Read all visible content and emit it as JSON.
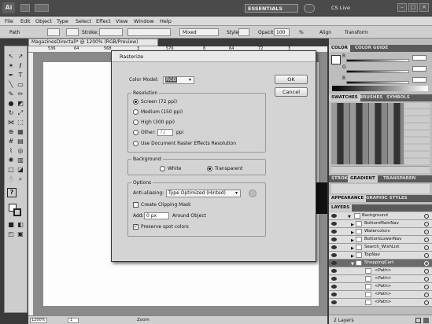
{
  "appbar": {
    "logo": "Ai",
    "workspace": "ESSENTIALS",
    "cslive": "CS Live",
    "win_min": "–",
    "win_max": "□",
    "win_close": "×"
  },
  "menu": {
    "items": [
      "File",
      "Edit",
      "Object",
      "Type",
      "Select",
      "Effect",
      "View",
      "Window",
      "Help"
    ]
  },
  "control": {
    "selection": "Path",
    "stroke_label": "Stroke:",
    "brush_value": "Mixed",
    "style_label": "Style:",
    "opacity_label": "Opacity:",
    "opacity_value": "100",
    "opacity_unit": "%",
    "align_label": "Align",
    "transform_label": "Transform"
  },
  "document": {
    "tab_title": "MagazinesDirectall* @ 1200% (RGB/Preview)",
    "ruler_ticks": [
      "536",
      "64",
      "568",
      "3",
      "576",
      "8",
      "64",
      "72",
      "3"
    ],
    "zoom": "1200%",
    "page": "1",
    "status": "Zoom"
  },
  "dialog": {
    "title": "Rasterize",
    "color_model_label": "Color Model:",
    "color_model_value": "RGB",
    "ok_label": "OK",
    "cancel_label": "Cancel",
    "resolution_group": "Resolution",
    "res_screen": "Screen (72 ppi)",
    "res_medium": "Medium (150 ppi)",
    "res_high": "High (300 ppi)",
    "res_other": "Other:",
    "res_other_value": "72",
    "res_other_unit": "ppi",
    "res_doc": "Use Document Raster Effects Resolution",
    "background_group": "Background",
    "bg_white": "White",
    "bg_transparent": "Transparent",
    "options_group": "Options",
    "antialias_label": "Anti-aliasing:",
    "antialias_value": "Type Optimized (Hinted)",
    "clipping_label": "Create Clipping Mask",
    "add_label": "Add:",
    "add_value": "0 px",
    "add_suffix": "Around Object",
    "preserve_label": "Preserve spot colors"
  },
  "panels": {
    "color_tab": "COLOR",
    "guide_tab": "COLOR GUIDE",
    "r": "R",
    "g": "G",
    "b": "B",
    "swatches_tab": "SWATCHES",
    "brushes_tab": "BRUSHES",
    "symbols_tab": "SYMBOLS",
    "stroke_tab": "STROK",
    "gradient_tab": "GRADIENT",
    "transparency_tab": "TRANSPAREN",
    "appearance_tab": "APPEARANCE",
    "graphic_styles_tab": "GRAPHIC STYLES",
    "layers_tab": "LAYERS",
    "layers_count": "2 Layers",
    "layers": [
      "Background",
      "BottomMainNav",
      "Watercolors",
      "BottomLowerNav",
      "Search_WishList",
      "TopNav",
      "ShoppingCart",
      "<Path>",
      "<Path>",
      "<Path>",
      "<Path>",
      "<Path>"
    ]
  }
}
